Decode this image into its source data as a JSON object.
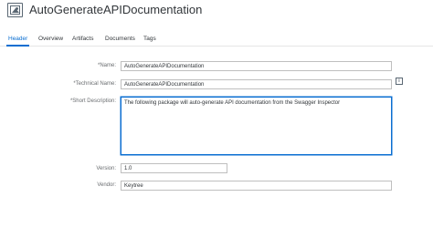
{
  "app": {
    "title": "AutoGenerateAPIDocumentation",
    "icon": "image-icon"
  },
  "tabs": [
    {
      "label": "Header",
      "active": true
    },
    {
      "label": "Overview",
      "active": false
    },
    {
      "label": "Artifacts",
      "active": false
    },
    {
      "label": "Documents",
      "active": false
    },
    {
      "label": "Tags",
      "active": false
    }
  ],
  "form": {
    "name_label": "*Name:",
    "name_value": "AutoGenerateAPIDocumentation",
    "technical_name_label": "*Technical Name:",
    "technical_name_value": "AutoGenerateAPIDocumentation",
    "info_glyph": "i",
    "short_description_label": "*Short Description:",
    "short_description_value": "The following package will auto-generate API documentation from the Swagger Inspector",
    "version_label": "Version:",
    "version_value": "1.0",
    "vendor_label": "Vendor:",
    "vendor_value": "Keytree"
  },
  "colors": {
    "accent": "#0a6ed1",
    "text": "#32363a",
    "label": "#6a6d70",
    "border": "#bfbfbf"
  }
}
